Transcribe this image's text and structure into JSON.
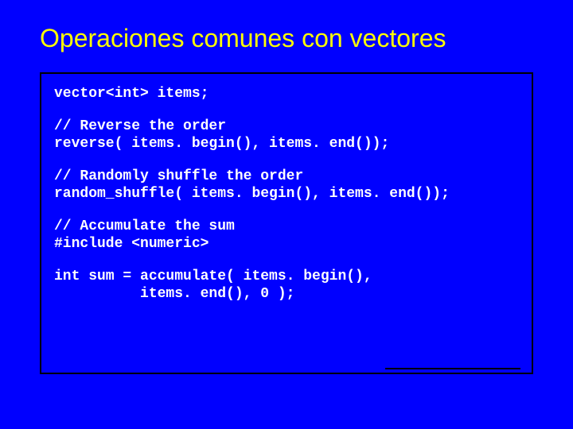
{
  "title": "Operaciones comunes con vectores",
  "code": {
    "l1": "vector<int> items;",
    "l2": "// Reverse the order",
    "l3": "reverse( items. begin(), items. end());",
    "l4": "// Randomly shuffle the order",
    "l5": "random_shuffle( items. begin(), items. end());",
    "l6": "// Accumulate the sum",
    "l7": "#include <numeric>",
    "l8": "int sum = accumulate( items. begin(),",
    "l9": "          items. end(), 0 );"
  }
}
